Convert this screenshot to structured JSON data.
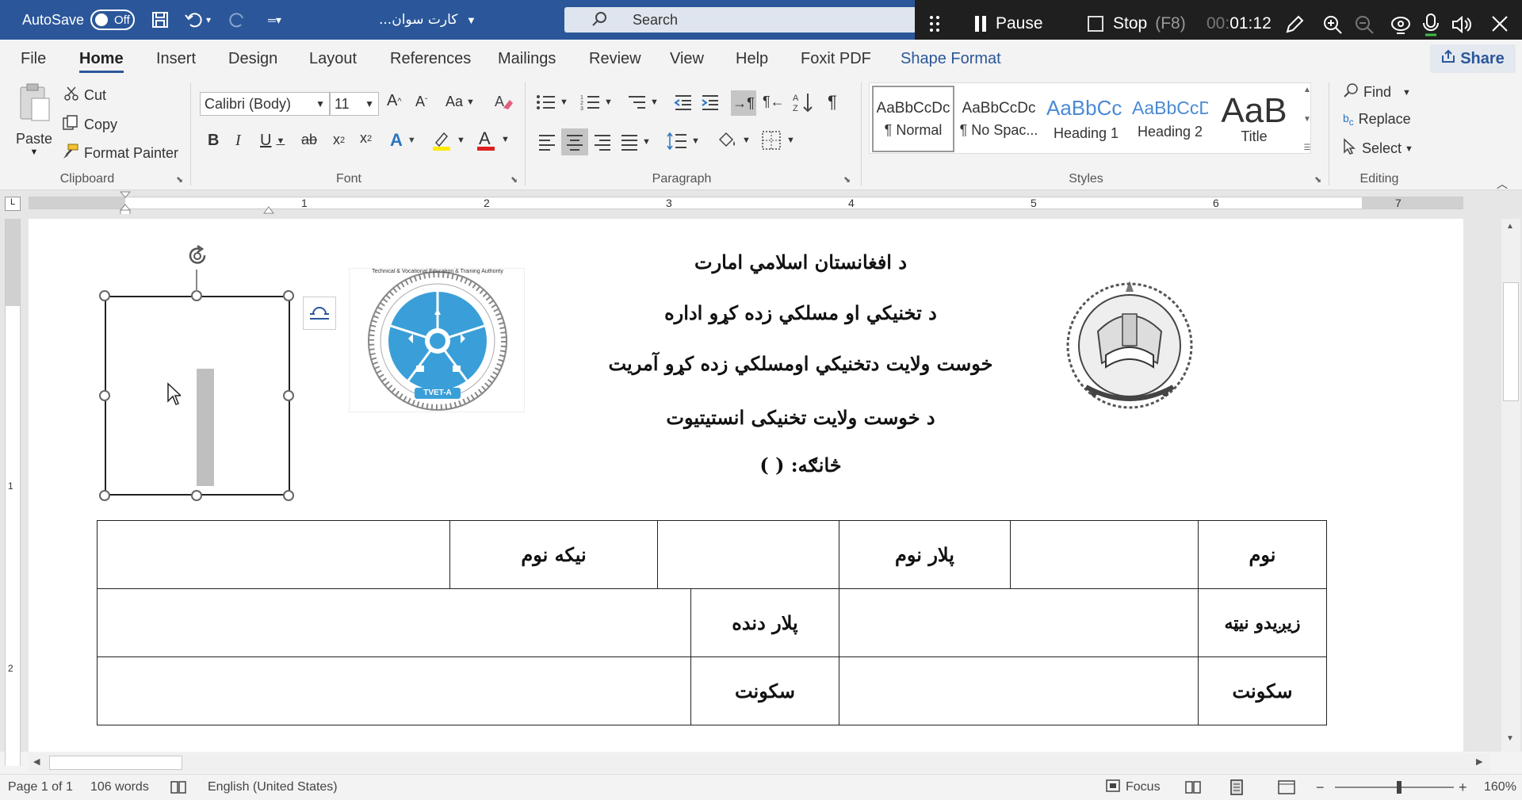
{
  "titlebar": {
    "autosave_label": "AutoSave",
    "autosave_state": "Off",
    "doc_title": "کارت سوان...",
    "search_placeholder": "Search"
  },
  "recorder": {
    "pause_label": "Pause",
    "stop_label": "Stop",
    "stop_shortcut": "(F8)",
    "timer_prefix": "00:",
    "timer": "01:12"
  },
  "menu": {
    "tabs": [
      "File",
      "Home",
      "Insert",
      "Design",
      "Layout",
      "References",
      "Mailings",
      "Review",
      "View",
      "Help",
      "Foxit PDF",
      "Shape Format"
    ],
    "active": "Home",
    "share_label": "Share"
  },
  "ribbon": {
    "clipboard": {
      "paste": "Paste",
      "cut": "Cut",
      "copy": "Copy",
      "format_painter": "Format Painter",
      "label": "Clipboard"
    },
    "font": {
      "family": "Calibri (Body)",
      "size": "11",
      "label": "Font",
      "case_label": "Aa"
    },
    "paragraph": {
      "label": "Paragraph"
    },
    "styles": {
      "label": "Styles",
      "items": [
        {
          "sample": "AaBbCcDc",
          "name": "¶ Normal"
        },
        {
          "sample": "AaBbCcDc",
          "name": "¶ No Spac..."
        },
        {
          "sample": "AaBbCc",
          "name": "Heading 1"
        },
        {
          "sample": "AaBbCcD",
          "name": "Heading 2"
        },
        {
          "sample": "AaB",
          "name": "Title"
        }
      ]
    },
    "editing": {
      "find": "Find",
      "replace": "Replace",
      "select": "Select",
      "label": "Editing"
    }
  },
  "ruler": {
    "numbers": [
      "1",
      "2",
      "3",
      "4",
      "5",
      "6",
      "7"
    ],
    "vnumbers": [
      "1",
      "2"
    ]
  },
  "document": {
    "heading_lines": [
      "د افغانستان اسلامي امارت",
      "د تخنيکي او مسلکي زده کړو اداره",
      "خوست ولایت دتخنيکي اومسلکي زده کړو آمریت",
      "د خوست ولایت تخنیکی  انستیتیوت",
      "څانګه: (                      )"
    ],
    "logo_text": {
      "ring_en": "Technical & Vocational Education & Training Authority",
      "abbr": "TVET-A"
    },
    "table": {
      "row1": {
        "name_label": "نوم",
        "father_label": "پلار نوم",
        "grandfather_label": "نیکه نوم"
      },
      "row2": {
        "birth_label": "زیږیدو نیټه",
        "father_job_label": "پلار دنده"
      },
      "row3": {
        "residence_label_1": "سکونت",
        "residence_label_2": "سکونت"
      }
    }
  },
  "status": {
    "page": "Page 1 of 1",
    "words": "106 words",
    "language": "English (United States)",
    "focus": "Focus",
    "zoom": "160%"
  },
  "colors": {
    "brand": "#2b579a",
    "recorder_bg": "#1f1f1f",
    "logo_blue": "#3a9fd8"
  }
}
